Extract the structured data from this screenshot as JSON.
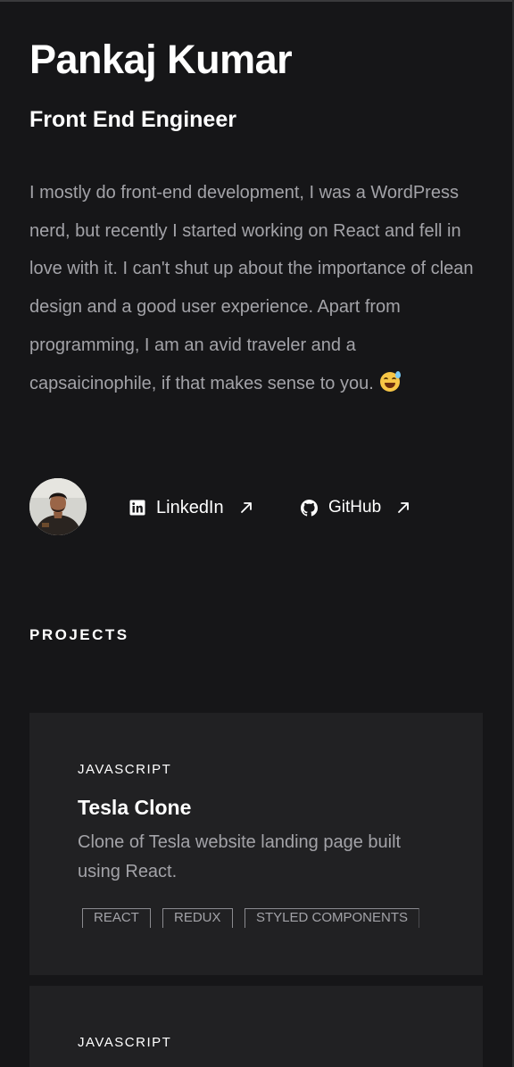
{
  "profile": {
    "name": "Pankaj Kumar",
    "role": "Front End Engineer",
    "bio": "I mostly do front-end development, I was a WordPress nerd, but recently I started working on React and fell in love with it. I can't shut up about the importance of clean design and a good user experience. Apart from programming, I am an avid traveler and a capsaicinophile, if that makes sense to you.",
    "bio_emoji": "grinning-face-with-sweat-icon"
  },
  "social": [
    {
      "label": "LinkedIn",
      "icon": "linkedin-icon",
      "arrow": "arrow-up-right-icon"
    },
    {
      "label": "GitHub",
      "icon": "github-icon",
      "arrow": "arrow-up-right-icon"
    }
  ],
  "projects_heading": "PROJECTS",
  "projects": [
    {
      "language": "JAVASCRIPT",
      "title": "Tesla Clone",
      "description": "Clone of Tesla website landing page built using React.",
      "tags": [
        "REACT",
        "REDUX",
        "STYLED COMPONENTS"
      ]
    },
    {
      "language": "JAVASCRIPT"
    }
  ],
  "colors": {
    "background": "#161618",
    "card": "#212123",
    "text_primary": "#ffffff",
    "text_muted": "#a3a3a8"
  }
}
